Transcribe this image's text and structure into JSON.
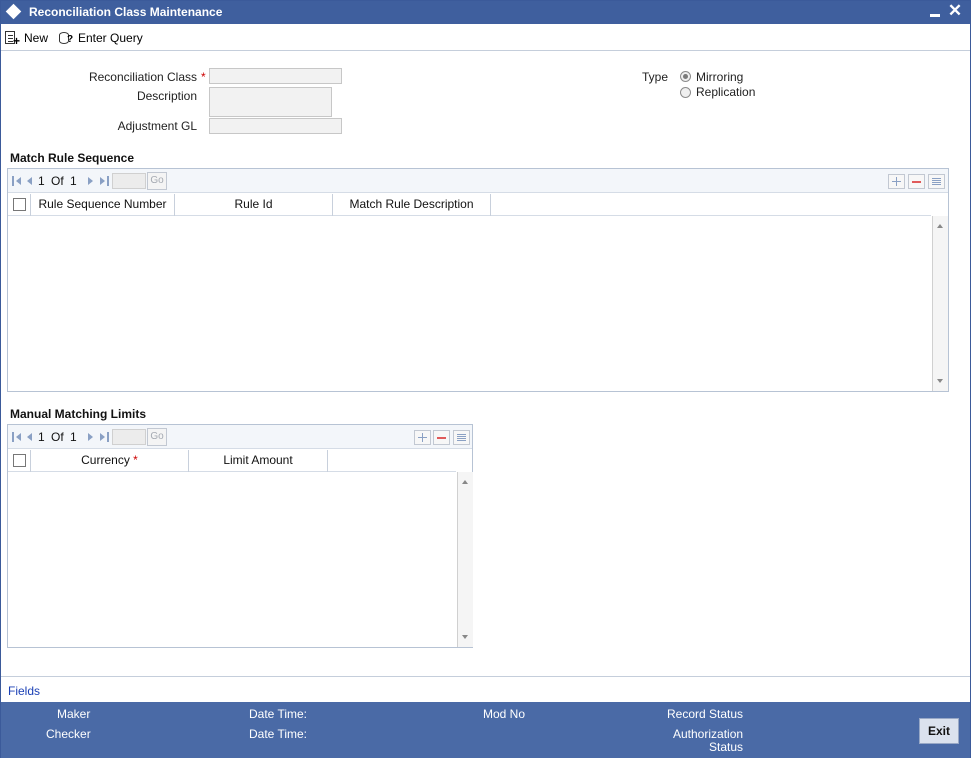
{
  "window": {
    "title": "Reconciliation Class Maintenance",
    "close_glyph": "✕"
  },
  "toolbar": {
    "new_label": "New",
    "enter_query_label": "Enter Query"
  },
  "form": {
    "reconciliation_class_label": "Reconciliation Class",
    "reconciliation_class_value": "",
    "description_label": "Description",
    "description_value": "",
    "adjustment_gl_label": "Adjustment GL",
    "adjustment_gl_value": "",
    "required_marker": "*",
    "type_label": "Type",
    "type_options": [
      "Mirroring",
      "Replication"
    ],
    "type_selected": "Mirroring"
  },
  "match_rule_sequence": {
    "title": "Match Rule Sequence",
    "pagination": {
      "current": "1",
      "of_label": "Of",
      "total": "1",
      "go_label": "Go"
    },
    "columns": [
      "Rule Sequence Number",
      "Rule Id",
      "Match Rule Description"
    ],
    "rows": []
  },
  "manual_matching_limits": {
    "title": "Manual Matching Limits",
    "pagination": {
      "current": "1",
      "of_label": "Of",
      "total": "1",
      "go_label": "Go"
    },
    "columns": [
      "Currency",
      "Limit Amount"
    ],
    "currency_required": "*",
    "rows": []
  },
  "footer": {
    "fields_link": "Fields",
    "maker_label": "Maker",
    "checker_label": "Checker",
    "date_time_label_1": "Date Time:",
    "date_time_label_2": "Date Time:",
    "mod_no_label": "Mod No",
    "record_status_label": "Record Status",
    "authorization_status_line1": "Authorization",
    "authorization_status_line2": "Status",
    "exit_label": "Exit"
  },
  "colors": {
    "titlebar": "#3f5f9e",
    "audit_bar": "#4a6aa6",
    "link": "#1a3fb5",
    "required": "#cc0000"
  },
  "icons": [
    "window-diamond-icon",
    "new-document-icon",
    "enter-query-icon",
    "minimize-icon",
    "close-icon",
    "first-page-icon",
    "previous-page-icon",
    "next-page-icon",
    "last-page-icon",
    "add-row-icon",
    "delete-row-icon",
    "single-view-icon"
  ]
}
